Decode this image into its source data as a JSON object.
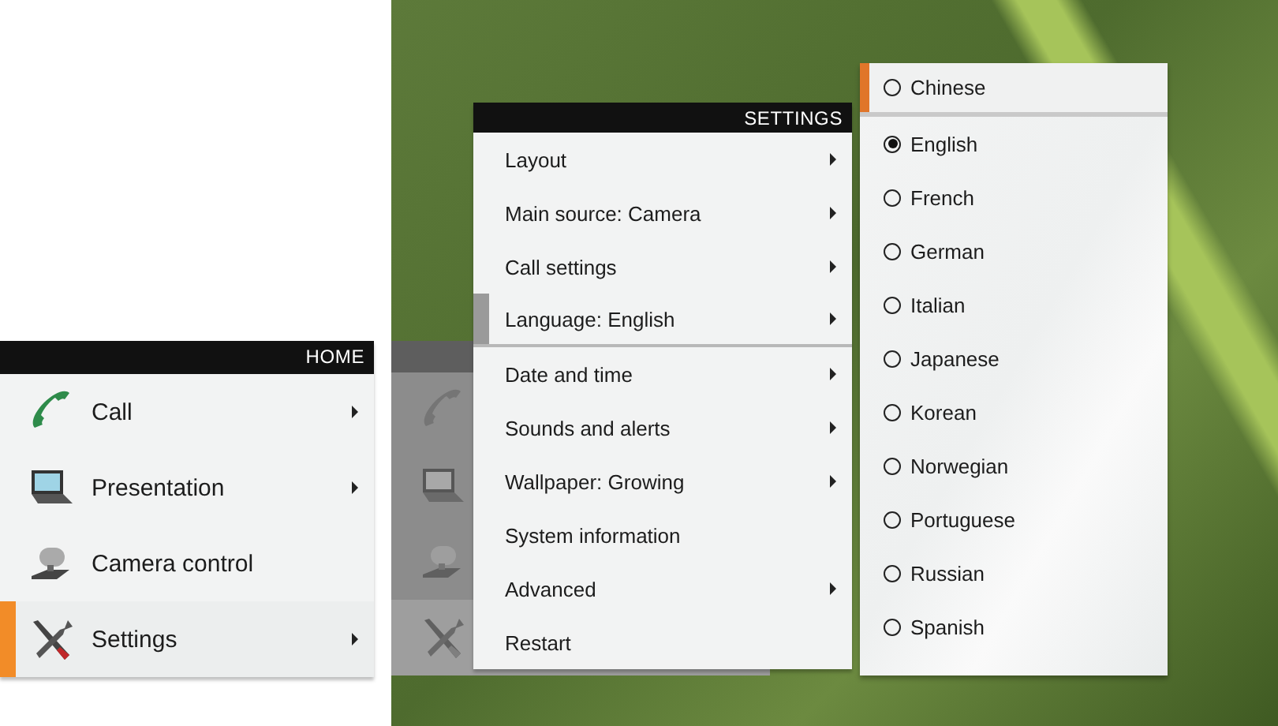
{
  "home_menu": {
    "title": "HOME",
    "items": [
      {
        "label": "Call",
        "kind": "phone",
        "has_submenu": true,
        "selected": false
      },
      {
        "label": "Presentation",
        "kind": "laptop",
        "has_submenu": true,
        "selected": false
      },
      {
        "label": "Camera control",
        "kind": "camera",
        "has_submenu": false,
        "selected": false
      },
      {
        "label": "Settings",
        "kind": "tools",
        "has_submenu": true,
        "selected": true
      }
    ]
  },
  "settings_menu": {
    "title": "SETTINGS",
    "items": [
      {
        "label": "Layout",
        "has_submenu": true,
        "selected": false
      },
      {
        "label": "Main source: Camera",
        "has_submenu": true,
        "selected": false
      },
      {
        "label": "Call settings",
        "has_submenu": true,
        "selected": false
      },
      {
        "label": "Language: English",
        "has_submenu": true,
        "selected": true
      },
      {
        "label": "Date and time",
        "has_submenu": true,
        "selected": false
      },
      {
        "label": "Sounds and alerts",
        "has_submenu": true,
        "selected": false
      },
      {
        "label": "Wallpaper: Growing",
        "has_submenu": true,
        "selected": false
      },
      {
        "label": "System information",
        "has_submenu": false,
        "selected": false
      },
      {
        "label": "Advanced",
        "has_submenu": true,
        "selected": false
      },
      {
        "label": "Restart",
        "has_submenu": false,
        "selected": false
      }
    ]
  },
  "language_menu": {
    "items": [
      {
        "label": "Chinese",
        "selected": false,
        "focused": true
      },
      {
        "label": "English",
        "selected": true,
        "focused": false
      },
      {
        "label": "French",
        "selected": false,
        "focused": false
      },
      {
        "label": "German",
        "selected": false,
        "focused": false
      },
      {
        "label": "Italian",
        "selected": false,
        "focused": false
      },
      {
        "label": "Japanese",
        "selected": false,
        "focused": false
      },
      {
        "label": "Korean",
        "selected": false,
        "focused": false
      },
      {
        "label": "Norwegian",
        "selected": false,
        "focused": false
      },
      {
        "label": "Portuguese",
        "selected": false,
        "focused": false
      },
      {
        "label": "Russian",
        "selected": false,
        "focused": false
      },
      {
        "label": "Spanish",
        "selected": false,
        "focused": false
      }
    ]
  }
}
